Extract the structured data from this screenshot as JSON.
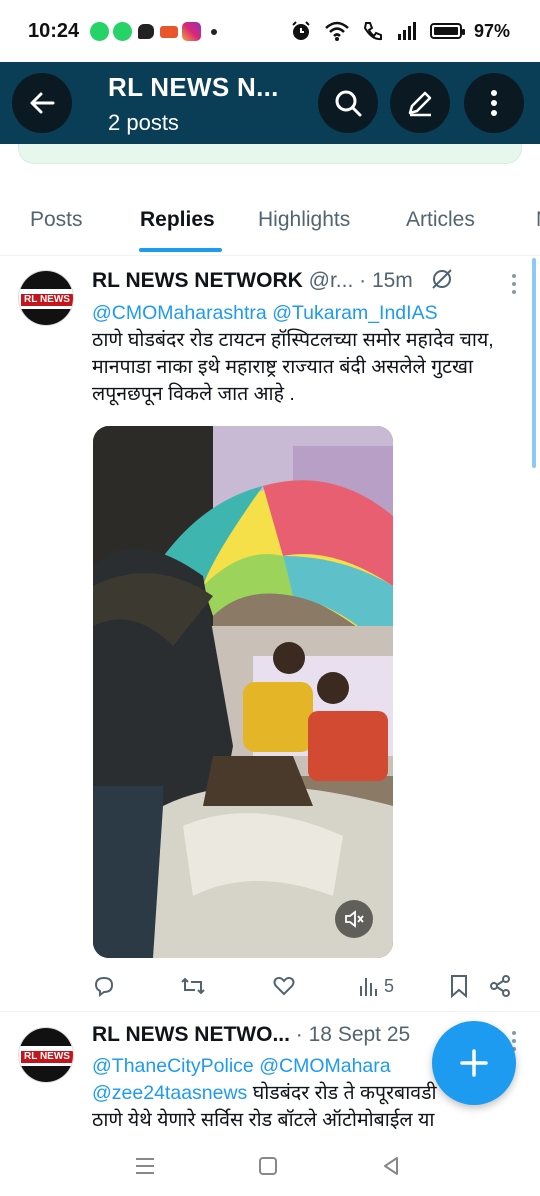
{
  "status_bar": {
    "time": "10:24",
    "battery": "97%",
    "notification_icons": [
      "whatsapp-icon",
      "whatsapp-icon",
      "chat-icon",
      "game-icon",
      "instagram-icon",
      "dot-icon"
    ],
    "system_icons": [
      "alarm-icon",
      "wifi-icon",
      "call-icon",
      "signal-icon",
      "battery-icon"
    ]
  },
  "header": {
    "title": "RL NEWS N...",
    "subtitle": "2 posts",
    "color": "#0a3d56"
  },
  "tabs": [
    {
      "label": "Posts",
      "active": false
    },
    {
      "label": "Replies",
      "active": true
    },
    {
      "label": "Highlights",
      "active": false
    },
    {
      "label": "Articles",
      "active": false
    },
    {
      "label": "M",
      "active": false
    }
  ],
  "avatar_logo_text": "RL NEWS",
  "posts": [
    {
      "author": "RL NEWS NETWORK",
      "handle": "@r...",
      "separator": " · ",
      "time": "15m",
      "mentions": [
        "@CMOMaharashtra",
        "@Tukaram_IndIAS"
      ],
      "text": "ठाणे घोडबंदर रोड टायटन हॉस्पिटलच्या समोर  महादेव चाय, मानपाडा नाका इथे महाराष्ट्र राज्यात बंदी असलेले गुटखा  लपूनछपून विकले जात आहे .",
      "media_type": "video",
      "views": "5"
    },
    {
      "author": "RL NEWS NETWO...",
      "handle": "",
      "separator": " · ",
      "time": "18 Sept 25",
      "mentions": [
        "@ThaneCityPolice",
        "@CMOMahara",
        "@zee24taasnews"
      ],
      "text": "घोडबंदर रोड ते कपूरबावडी",
      "text_line3": "ठाणे येथे  येणारे सर्विस रोड  बॉटले ऑटोमोबाईल या"
    }
  ],
  "accent": "#1d9bf0"
}
